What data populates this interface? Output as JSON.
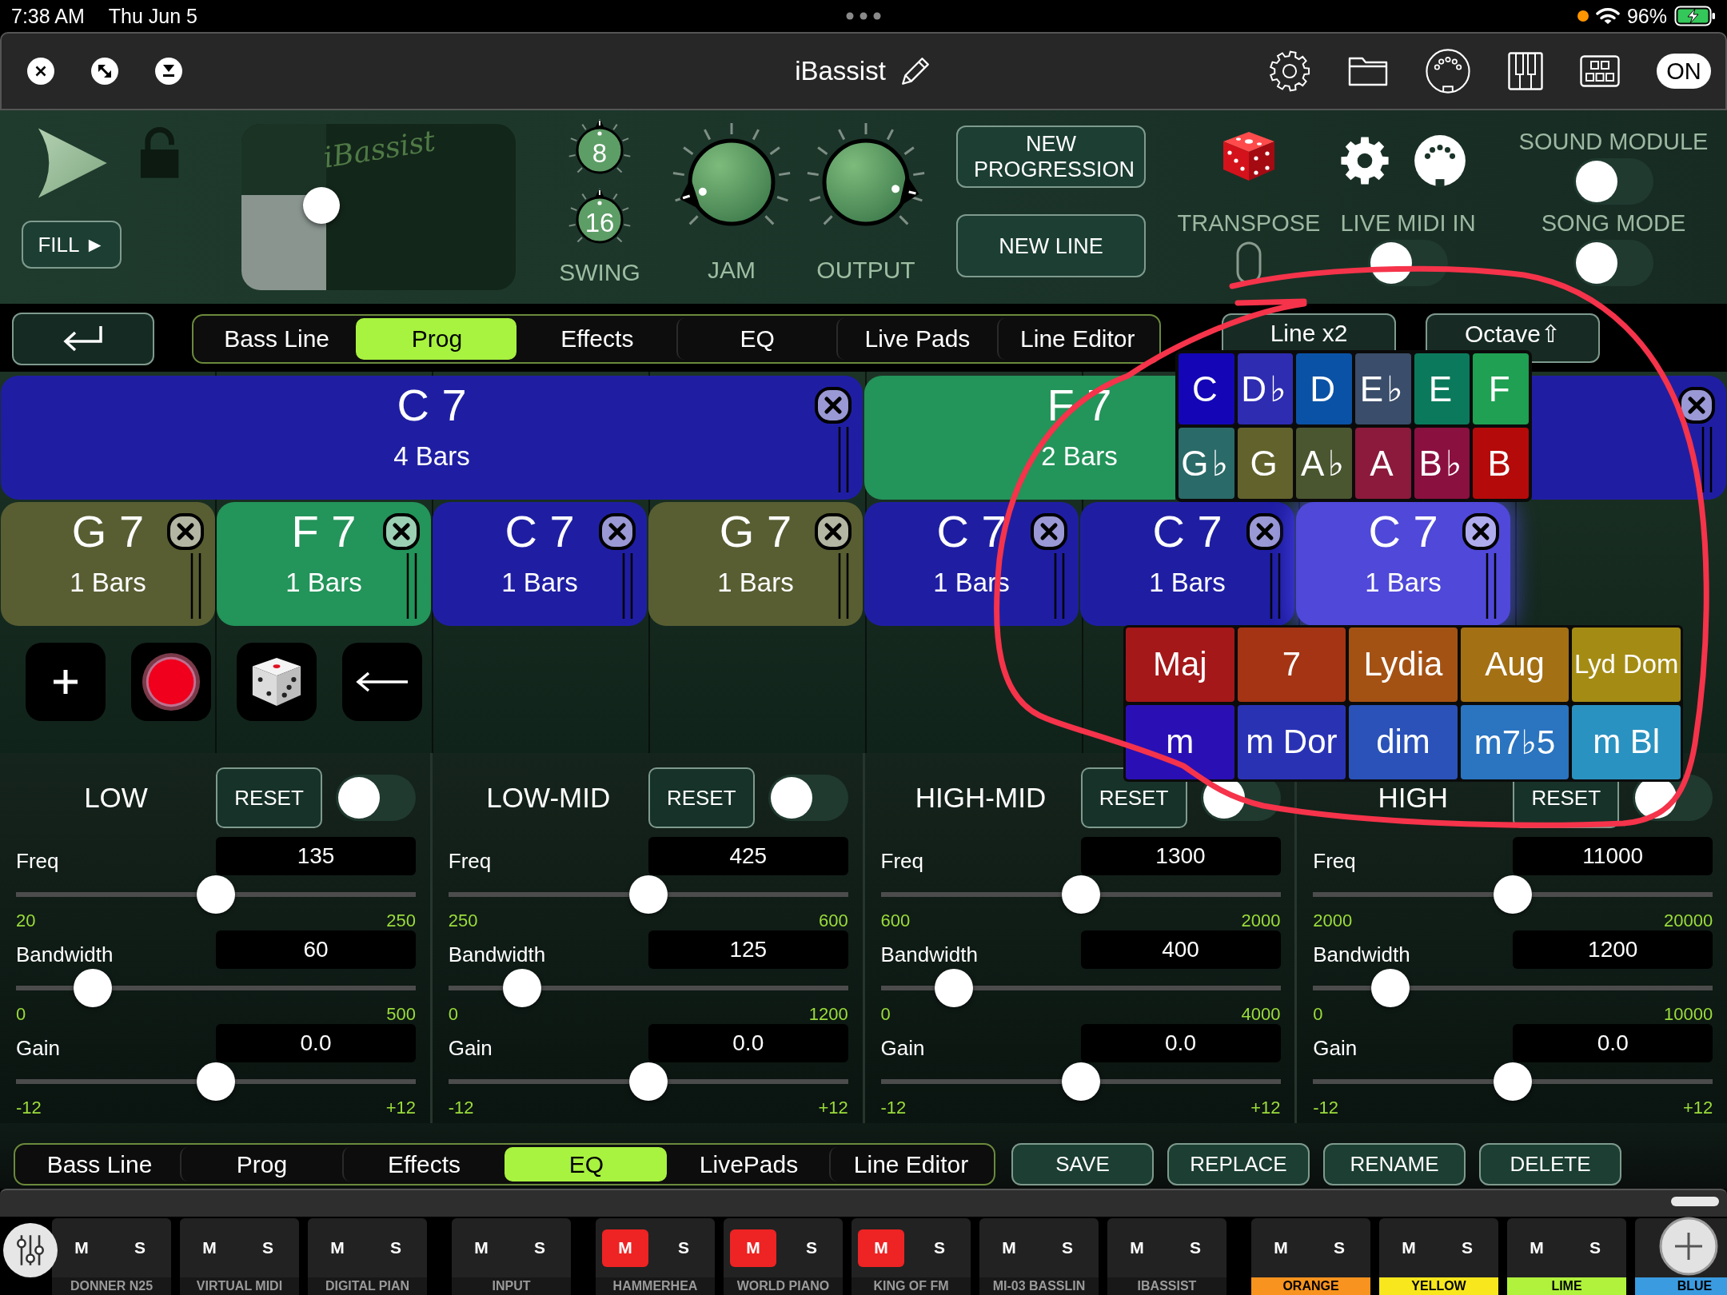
{
  "status_bar": {
    "time": "7:38 AM",
    "date": "Thu Jun 5",
    "battery": "96%"
  },
  "title_bar": {
    "title": "iBassist",
    "power_button": "ON"
  },
  "controls": {
    "fill_button": "FILL ►",
    "pad": {
      "logo": "iBassist",
      "x": {
        "level": 0.31
      },
      "y": {
        "level": 0.57
      }
    },
    "swing": {
      "label": "SWING",
      "knobs": [
        "8",
        "16"
      ]
    },
    "knobs": [
      {
        "label": "JAM",
        "level": 0.1
      },
      {
        "label": "OUTPUT",
        "level": 0.88
      }
    ],
    "buttons": [
      "NEW PROGRESSION",
      "NEW LINE"
    ],
    "transpose": {
      "label": "TRANSPOSE"
    },
    "toggles": [
      {
        "label": "LIVE MIDI IN",
        "on": false
      },
      {
        "label": "SOUND MODULE",
        "on": false
      },
      {
        "label": "SONG MODE",
        "on": false
      }
    ]
  },
  "tabs": [
    {
      "label": "Bass Line",
      "selected": false
    },
    {
      "label": "Prog",
      "selected": true
    },
    {
      "label": "Effects",
      "selected": false
    },
    {
      "label": "EQ",
      "selected": false
    },
    {
      "label": "Live Pads",
      "selected": false
    },
    {
      "label": "Line Editor",
      "selected": false
    }
  ],
  "line_buttons": [
    "Line x2",
    "Octave⇧"
  ],
  "chord_rows": [
    {
      "chords": [
        {
          "name": "C 7",
          "bars": "4 Bars",
          "kind": "long",
          "color": "#1f1ea3",
          "selected": false,
          "removable": true
        },
        {
          "name": "F 7",
          "bars": "2 Bars",
          "kind": "double",
          "color": "#23945a",
          "selected": false,
          "removable": false
        },
        {
          "kind": "double",
          "color": "#1f1ea3",
          "selected": false,
          "removable": true
        }
      ]
    },
    {
      "chords": [
        {
          "name": "G 7",
          "bars": "1 Bars",
          "kind": "single",
          "color": "#585e32",
          "selected": false,
          "removable": true
        },
        {
          "name": "F 7",
          "bars": "1 Bars",
          "kind": "single",
          "color": "#23945a",
          "selected": false,
          "removable": true
        },
        {
          "name": "C 7",
          "bars": "1 Bars",
          "kind": "single",
          "color": "#1f1ea3",
          "selected": false,
          "removable": true
        },
        {
          "name": "G 7",
          "bars": "1 Bars",
          "kind": "single",
          "color": "#585e32",
          "selected": false,
          "removable": true
        },
        {
          "name": "C 7",
          "bars": "1 Bars",
          "kind": "single",
          "color": "#1f1ea3",
          "selected": false,
          "removable": true
        },
        {
          "name": "C 7",
          "bars": "1 Bars",
          "kind": "single",
          "color": "#1f1ea3",
          "selected": false,
          "removable": true
        },
        {
          "name": "C 7",
          "bars": "1 Bars",
          "kind": "single",
          "color": "#4f48d8",
          "selected": true,
          "removable": true
        }
      ]
    }
  ],
  "root_picker": [
    {
      "label": "C",
      "color": "#1406b6"
    },
    {
      "label": "D♭",
      "color": "#2e2cb0"
    },
    {
      "label": "D",
      "color": "#0a52a6"
    },
    {
      "label": "E♭",
      "color": "#3a4d6a"
    },
    {
      "label": "E",
      "color": "#0b7a5c"
    },
    {
      "label": "F",
      "color": "#1fa052"
    },
    {
      "label": "G♭",
      "color": "#2a6a68"
    },
    {
      "label": "G",
      "color": "#62622c"
    },
    {
      "label": "A♭",
      "color": "#4a5630"
    },
    {
      "label": "A",
      "color": "#8c1a3c"
    },
    {
      "label": "B♭",
      "color": "#8a1040"
    },
    {
      "label": "B",
      "color": "#b40a0a"
    }
  ],
  "quality_picker": [
    {
      "label": "Maj",
      "color": "#a4181a"
    },
    {
      "label": "7",
      "color": "#a43414"
    },
    {
      "label": "Lydia",
      "color": "#a45214"
    },
    {
      "label": "Aug",
      "color": "#a47014"
    },
    {
      "label": "Lyd Dom",
      "color": "#a48c14"
    },
    {
      "label": "m",
      "color": "#2a10b4"
    },
    {
      "label": "m Dor",
      "color": "#2a32b4"
    },
    {
      "label": "dim",
      "color": "#2a52b8"
    },
    {
      "label": "m7♭5",
      "color": "#2a74c0"
    },
    {
      "label": "m Bl",
      "color": "#2a92c0"
    }
  ],
  "eq_bands": [
    {
      "title": "LOW",
      "reset": "RESET",
      "on": false,
      "params": [
        {
          "label": "Freq",
          "value": "135",
          "min": "20",
          "max": "250",
          "level": 0.5
        },
        {
          "label": "Bandwidth",
          "value": "60",
          "min": "0",
          "max": "500",
          "level": 0.16
        },
        {
          "label": "Gain",
          "value": "0.0",
          "min": "-12",
          "max": "+12",
          "level": 0.5
        }
      ]
    },
    {
      "title": "LOW-MID",
      "reset": "RESET",
      "on": false,
      "params": [
        {
          "label": "Freq",
          "value": "425",
          "min": "250",
          "max": "600",
          "level": 0.5
        },
        {
          "label": "Bandwidth",
          "value": "125",
          "min": "0",
          "max": "1200",
          "level": 0.15
        },
        {
          "label": "Gain",
          "value": "0.0",
          "min": "-12",
          "max": "+12",
          "level": 0.5
        }
      ]
    },
    {
      "title": "HIGH-MID",
      "reset": "RESET",
      "on": false,
      "params": [
        {
          "label": "Freq",
          "value": "1300",
          "min": "600",
          "max": "2000",
          "level": 0.5
        },
        {
          "label": "Bandwidth",
          "value": "400",
          "min": "0",
          "max": "4000",
          "level": 0.15
        },
        {
          "label": "Gain",
          "value": "0.0",
          "min": "-12",
          "max": "+12",
          "level": 0.5
        }
      ]
    },
    {
      "title": "HIGH",
      "reset": "RESET",
      "on": false,
      "params": [
        {
          "label": "Freq",
          "value": "11000",
          "min": "2000",
          "max": "20000",
          "level": 0.5
        },
        {
          "label": "Bandwidth",
          "value": "1200",
          "min": "0",
          "max": "10000",
          "level": 0.16
        },
        {
          "label": "Gain",
          "value": "0.0",
          "min": "-12",
          "max": "+12",
          "level": 0.5
        }
      ]
    }
  ],
  "bottom_tabs": [
    {
      "label": "Bass Line",
      "selected": false
    },
    {
      "label": "Prog",
      "selected": false
    },
    {
      "label": "Effects",
      "selected": false
    },
    {
      "label": "EQ",
      "selected": true
    },
    {
      "label": "LivePads",
      "selected": false
    },
    {
      "label": "Line Editor",
      "selected": false
    }
  ],
  "actions": [
    "SAVE",
    "REPLACE",
    "RENAME",
    "DELETE"
  ],
  "mixer": {
    "groups": [
      {
        "channels": [
          {
            "name": "DONNER N25",
            "mute": "M",
            "solo": "S",
            "muted": false
          },
          {
            "name": "VIRTUAL MIDI",
            "mute": "M",
            "solo": "S",
            "muted": false
          },
          {
            "name": "DIGITAL PIAN",
            "mute": "M",
            "solo": "S",
            "muted": false
          }
        ]
      },
      {
        "channels": [
          {
            "name": "INPUT",
            "mute": "M",
            "solo": "S",
            "muted": false
          }
        ]
      },
      {
        "channels": [
          {
            "name": "HAMMERHEA",
            "mute": "M",
            "solo": "S",
            "muted": true
          },
          {
            "name": "WORLD PIANO",
            "mute": "M",
            "solo": "S",
            "muted": true
          },
          {
            "name": "KING OF FM",
            "mute": "M",
            "solo": "S",
            "muted": true
          },
          {
            "name": "MI-03 BASSLIN",
            "mute": "M",
            "solo": "S",
            "muted": false
          },
          {
            "name": "IBASSIST",
            "mute": "M",
            "solo": "S",
            "muted": false
          }
        ]
      },
      {
        "channels": [
          {
            "name": "ORANGE",
            "mute": "M",
            "solo": "S",
            "muted": false,
            "color": "#f7931e"
          },
          {
            "name": "YELLOW",
            "mute": "M",
            "solo": "S",
            "muted": false,
            "color": "#f8e71c"
          },
          {
            "name": "LIME",
            "mute": "M",
            "solo": "S",
            "muted": false,
            "color": "#b0f23c"
          },
          {
            "name": "BLUE",
            "color": "#3a9be0"
          }
        ]
      }
    ]
  }
}
